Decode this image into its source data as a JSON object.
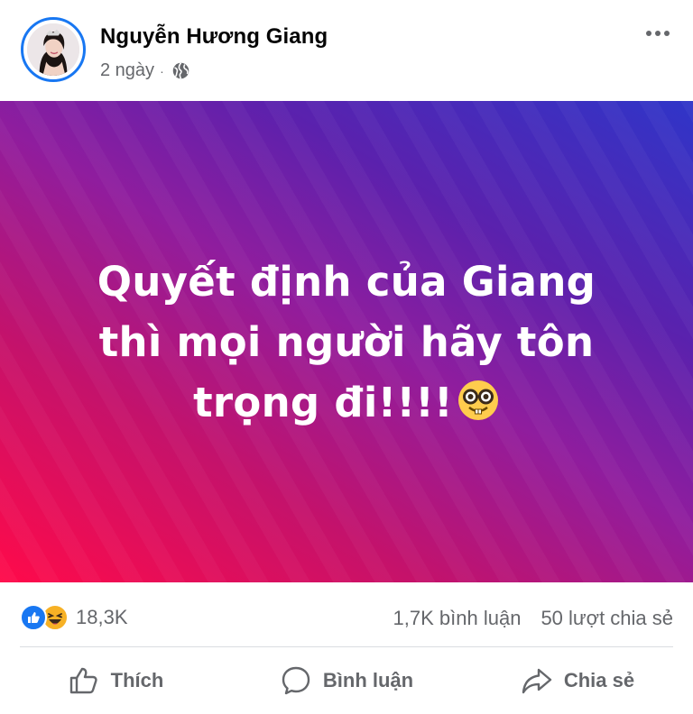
{
  "post": {
    "author": "Nguyễn Hương Giang",
    "time": "2 ngày",
    "separator": "·",
    "privacy_icon": "globe-icon",
    "text": "Quyết định của Giang thì mọi người hãy tôn trọng đi!!!!",
    "emoji": "nerd-face-emoji"
  },
  "stats": {
    "reaction_icons": [
      "like-icon",
      "haha-icon"
    ],
    "reaction_count": "18,3K",
    "comment_count": "1,7K bình luận",
    "share_count": "50 lượt chia sẻ"
  },
  "actions": {
    "like_label": "Thích",
    "comment_label": "Bình luận",
    "share_label": "Chia sẻ"
  },
  "colors": {
    "accent": "#1877f2",
    "text_secondary": "#65676b",
    "gradient_start": "#ff0a4a",
    "gradient_end": "#2f35c8",
    "haha": "#f7b125"
  }
}
